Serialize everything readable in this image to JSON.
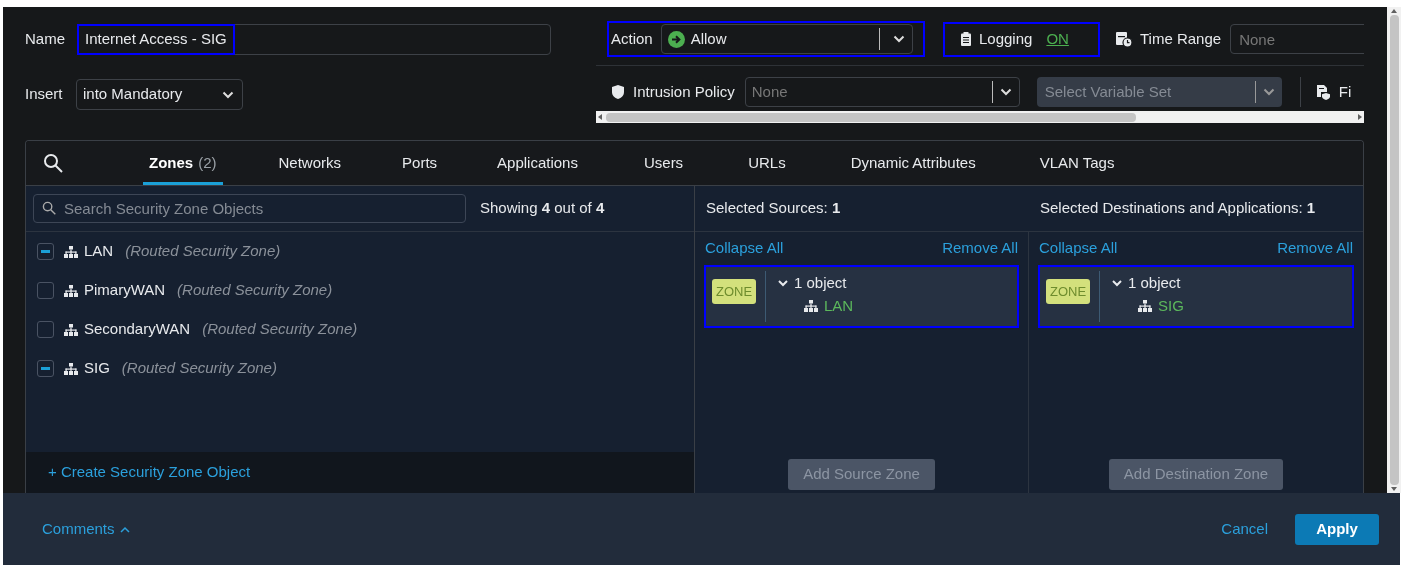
{
  "name": {
    "label": "Name",
    "value": "Internet Access - SIG",
    "highlighted": true
  },
  "action": {
    "label": "Action",
    "value": "Allow",
    "highlighted": true
  },
  "logging": {
    "label": "Logging",
    "value": "ON",
    "highlighted": true
  },
  "time_range": {
    "label": "Time Range",
    "placeholder": "None"
  },
  "insert": {
    "label": "Insert",
    "value": "into Mandatory"
  },
  "intrusion_policy": {
    "label": "Intrusion Policy",
    "placeholder": "None"
  },
  "variable_set": {
    "placeholder": "Select Variable Set",
    "disabled": true
  },
  "file_policy": {
    "label": "Fi"
  },
  "tabs": [
    {
      "label": "Zones",
      "count": "(2)",
      "selected": true
    },
    {
      "label": "Networks",
      "selected": false
    },
    {
      "label": "Ports",
      "selected": false
    },
    {
      "label": "Applications",
      "selected": false
    },
    {
      "label": "Users",
      "selected": false
    },
    {
      "label": "URLs",
      "selected": false
    },
    {
      "label": "Dynamic Attributes",
      "selected": false
    },
    {
      "label": "VLAN Tags",
      "selected": false
    }
  ],
  "zone_search": {
    "placeholder": "Search Security Zone Objects"
  },
  "showing": "Showing **4** out of **4**",
  "zones": [
    {
      "name": "LAN",
      "type": "(Routed Security Zone)",
      "checked": true
    },
    {
      "name": "PimaryWAN",
      "type": "(Routed Security Zone)",
      "checked": false
    },
    {
      "name": "SecondaryWAN",
      "type": "(Routed Security Zone)",
      "checked": false
    },
    {
      "name": "SIG",
      "type": "(Routed Security Zone)",
      "checked": true
    }
  ],
  "create_link": "+ Create Security Zone Object",
  "selected": [
    {
      "title": "Selected Sources: **1**",
      "collapse": "Collapse All",
      "remove": "Remove All",
      "groups": [
        {
          "tag": "ZONE",
          "summary": "1 object",
          "expanded": true,
          "highlighted": true,
          "items": [
            "LAN"
          ]
        }
      ],
      "add_button": {
        "label": "Add Source Zone",
        "disabled": true
      }
    },
    {
      "title": "Selected Destinations and Applications: **1**",
      "collapse": "Collapse All",
      "remove": "Remove All",
      "groups": [
        {
          "tag": "ZONE",
          "summary": "1 object",
          "expanded": true,
          "highlighted": true,
          "items": [
            "SIG"
          ]
        }
      ],
      "add_button": {
        "label": "Add Destination Zone",
        "disabled": true
      }
    }
  ],
  "footer": {
    "comments": "Comments",
    "cancel": "Cancel",
    "apply": "Apply"
  }
}
